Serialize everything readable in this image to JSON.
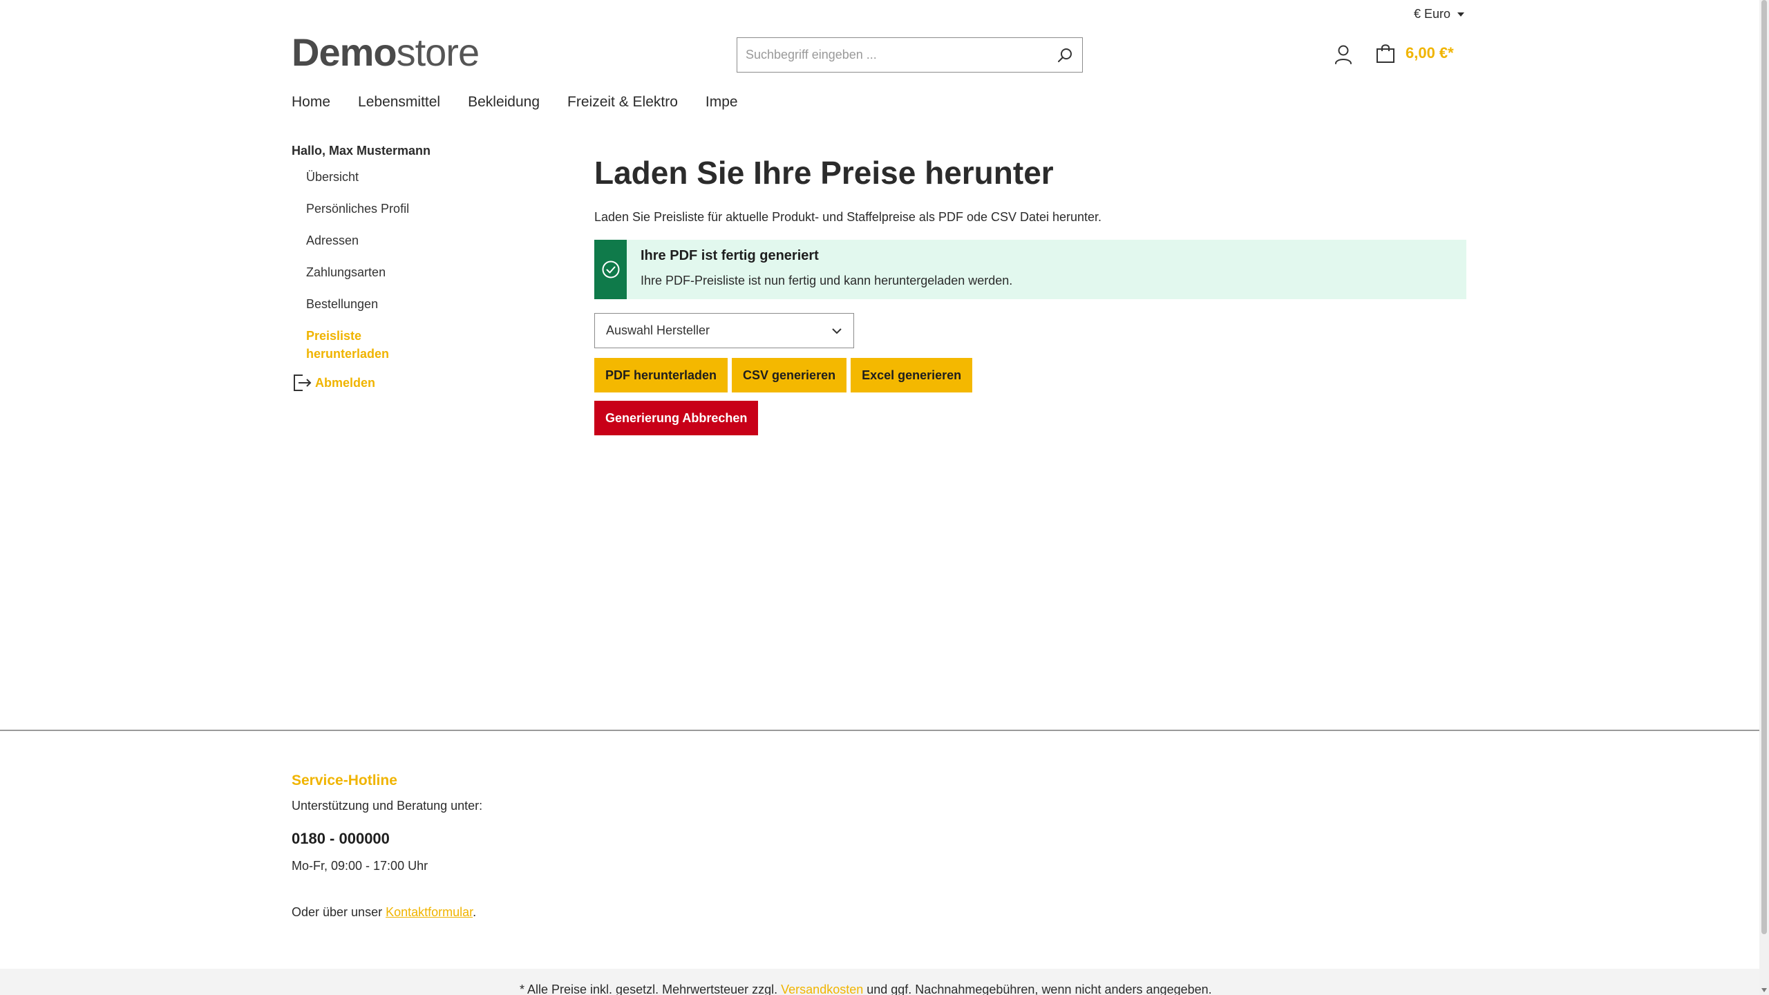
{
  "topbar": {
    "currency": "€ Euro"
  },
  "header": {
    "logo_bold": "Demo",
    "logo_light": "store",
    "search_placeholder": "Suchbegriff eingeben ...",
    "cart_total": "6,00 €*"
  },
  "nav": {
    "items": [
      "Home",
      "Lebensmittel",
      "Bekleidung",
      "Freizeit & Elektro",
      "Impe"
    ]
  },
  "sidebar": {
    "greeting": "Hallo, Max Mustermann",
    "items": [
      "Übersicht",
      "Persönliches Profil",
      "Adressen",
      "Zahlungsarten",
      "Bestellungen",
      "Preisliste herunterladen"
    ],
    "active_index": 5,
    "logout": "Abmelden"
  },
  "main": {
    "title": "Laden Sie Ihre Preise herunter",
    "intro": "Laden Sie Preisliste für aktuelle Produkt- und Staffelpreise als PDF ode CSV Datei herunter.",
    "alert_title": "Ihre PDF ist fertig generiert",
    "alert_text": "Ihre PDF-Preisliste ist nun fertig und kann heruntergeladen werden.",
    "select_value": "Auswahl Hersteller",
    "buttons": {
      "pdf": "PDF herunterladen",
      "csv": "CSV generieren",
      "excel": "Excel generieren",
      "cancel": "Generierung Abbrechen"
    }
  },
  "footer": {
    "hotline_title": "Service-Hotline",
    "support": "Unterstützung und Beratung unter:",
    "phone": "0180 - 000000",
    "hours": "Mo-Fr, 09:00 - 17:00 Uhr",
    "contact_prefix": "Oder über unser ",
    "contact_link": "Kontaktformular",
    "contact_suffix": ".",
    "note_prefix": "* Alle Preise inkl. gesetzl. Mehrwertsteuer zzgl. ",
    "note_link": "Versandkosten",
    "note_suffix": " und ggf. Nachnahmegebühren, wenn nicht anders angegeben."
  },
  "colors": {
    "accent": "#f0b400",
    "success": "#0f7a4a",
    "danger": "#c80018"
  }
}
